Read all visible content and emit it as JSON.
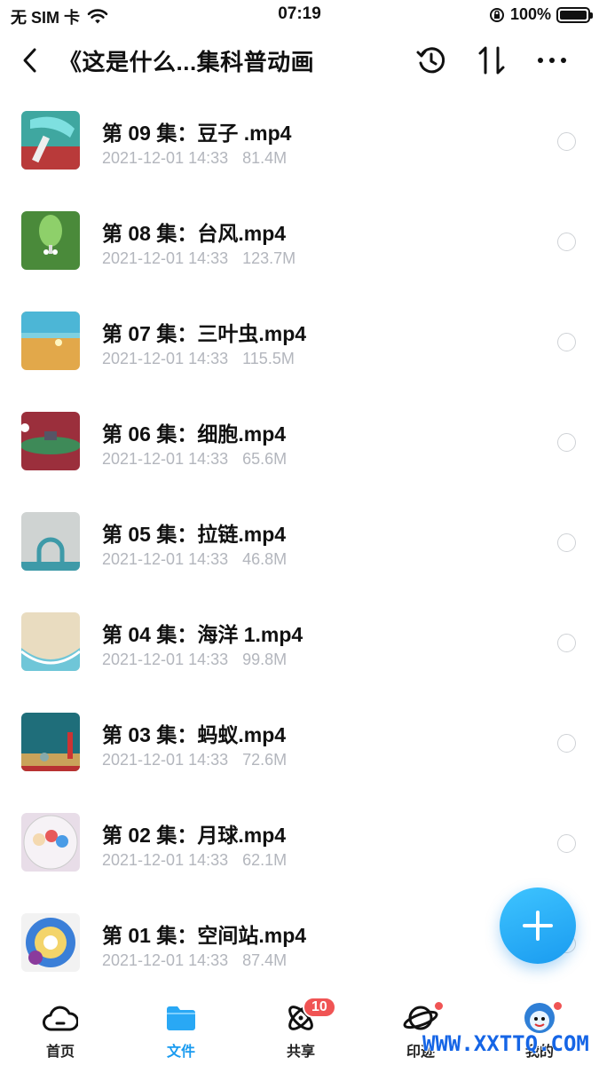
{
  "status": {
    "carrier": "无 SIM 卡",
    "time": "07:19",
    "battery": "100%"
  },
  "header": {
    "title": "《这是什么...集科普动画"
  },
  "files": [
    {
      "name": "第 09 集：豆子 .mp4",
      "date": "2021-12-01 14:33",
      "size": "81.4M"
    },
    {
      "name": "第 08 集：台风.mp4",
      "date": "2021-12-01 14:33",
      "size": "123.7M"
    },
    {
      "name": "第 07 集：三叶虫.mp4",
      "date": "2021-12-01 14:33",
      "size": "115.5M"
    },
    {
      "name": "第 06 集：细胞.mp4",
      "date": "2021-12-01 14:33",
      "size": "65.6M"
    },
    {
      "name": "第 05 集：拉链.mp4",
      "date": "2021-12-01 14:33",
      "size": "46.8M"
    },
    {
      "name": "第 04 集：海洋 1.mp4",
      "date": "2021-12-01 14:33",
      "size": "99.8M"
    },
    {
      "name": "第 03 集：蚂蚁.mp4",
      "date": "2021-12-01 14:33",
      "size": "72.6M"
    },
    {
      "name": "第 02 集：月球.mp4",
      "date": "2021-12-01 14:33",
      "size": "62.1M"
    },
    {
      "name": "第 01 集：空间站.mp4",
      "date": "2021-12-01 14:33",
      "size": "87.4M"
    }
  ],
  "tabs": [
    {
      "label": "首页",
      "icon": "cloud-icon"
    },
    {
      "label": "文件",
      "icon": "folder-icon"
    },
    {
      "label": "共享",
      "icon": "atom-icon",
      "badge": "10"
    },
    {
      "label": "印迹",
      "icon": "planet-icon"
    },
    {
      "label": "我的",
      "icon": "avatar-icon"
    }
  ],
  "watermark": "WWW.XXTTQ.COM",
  "colors": {
    "accent": "#1a9bf0",
    "badge": "#f05454",
    "meta_text": "#b3b6bd"
  }
}
